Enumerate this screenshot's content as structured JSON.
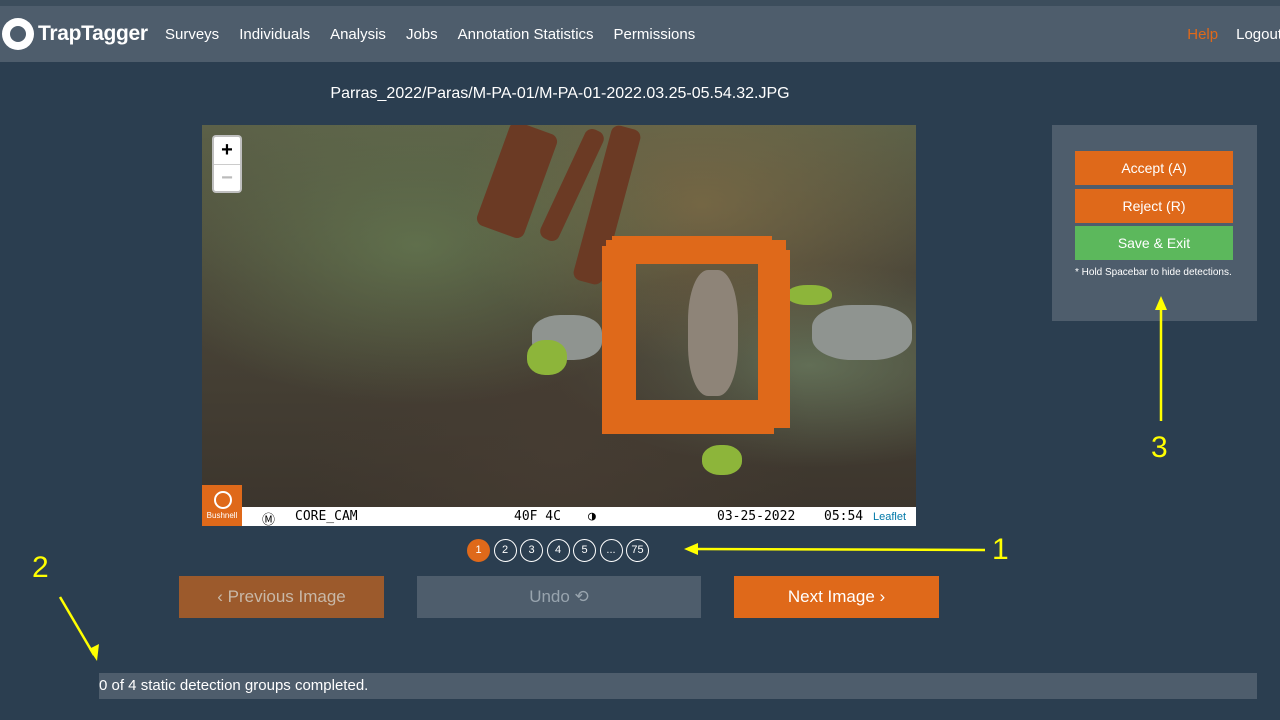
{
  "navbar": {
    "brand": "TrapTagger",
    "links": [
      "Surveys",
      "Individuals",
      "Analysis",
      "Jobs",
      "Annotation Statistics",
      "Permissions"
    ],
    "help": "Help",
    "logout": "Logout"
  },
  "image": {
    "title": "Parras_2022/Paras/M-PA-01/M-PA-01-2022.03.25-05.54.32.JPG",
    "zoom_in": "+",
    "zoom_out": "−",
    "overlay": {
      "logo_text": "Bushnell",
      "camera": "CORE_CAM",
      "temp": "40F 4C",
      "date": "03-25-2022",
      "time": "05:54",
      "attribution": "Leaflet"
    }
  },
  "pager": {
    "pages": [
      "1",
      "2",
      "3",
      "4",
      "5",
      "...",
      "75"
    ],
    "active_index": 0
  },
  "buttons": {
    "prev": "‹ Previous Image",
    "undo": "Undo ⟲",
    "next": "Next Image ›"
  },
  "panel": {
    "accept": "Accept (A)",
    "reject": "Reject (R)",
    "save_exit": "Save & Exit",
    "note": "* Hold Spacebar to hide detections."
  },
  "status": "0 of 4 static detection groups completed.",
  "callouts": [
    "1",
    "2",
    "3"
  ],
  "colors": {
    "background": "#2b3e50",
    "navbar": "#4e5d6c",
    "accent": "#df691a",
    "success": "#5cb85c",
    "annotation": "#ffff00"
  }
}
